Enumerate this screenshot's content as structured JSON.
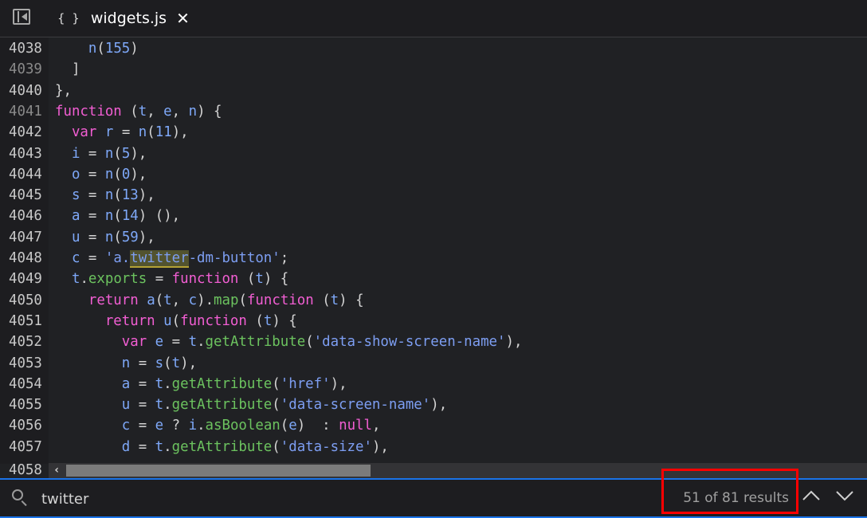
{
  "tab": {
    "icon": "braces-icon",
    "braces": "{ }",
    "title": "widgets.js"
  },
  "code_lines": [
    {
      "num": "4038",
      "dim": false,
      "tokens": [
        [
          "p",
          "    "
        ],
        [
          "id",
          "n"
        ],
        [
          "p",
          "("
        ],
        [
          "num",
          "155"
        ],
        [
          "p",
          ")"
        ]
      ]
    },
    {
      "num": "4039",
      "dim": true,
      "tokens": [
        [
          "p",
          "  ]"
        ]
      ]
    },
    {
      "num": "4040",
      "dim": false,
      "tokens": [
        [
          "p",
          "},"
        ]
      ]
    },
    {
      "num": "4041",
      "dim": true,
      "tokens": [
        [
          "kw",
          "function"
        ],
        [
          "p",
          " ("
        ],
        [
          "id",
          "t"
        ],
        [
          "p",
          ", "
        ],
        [
          "id",
          "e"
        ],
        [
          "p",
          ", "
        ],
        [
          "id",
          "n"
        ],
        [
          "p",
          ") {"
        ]
      ]
    },
    {
      "num": "4042",
      "dim": false,
      "tokens": [
        [
          "p",
          "  "
        ],
        [
          "kw",
          "var"
        ],
        [
          "p",
          " "
        ],
        [
          "id",
          "r"
        ],
        [
          "p",
          " = "
        ],
        [
          "id",
          "n"
        ],
        [
          "p",
          "("
        ],
        [
          "num",
          "11"
        ],
        [
          "p",
          "),"
        ]
      ]
    },
    {
      "num": "4043",
      "dim": false,
      "tokens": [
        [
          "p",
          "  "
        ],
        [
          "id",
          "i"
        ],
        [
          "p",
          " = "
        ],
        [
          "id",
          "n"
        ],
        [
          "p",
          "("
        ],
        [
          "num",
          "5"
        ],
        [
          "p",
          "),"
        ]
      ]
    },
    {
      "num": "4044",
      "dim": false,
      "tokens": [
        [
          "p",
          "  "
        ],
        [
          "id",
          "o"
        ],
        [
          "p",
          " = "
        ],
        [
          "id",
          "n"
        ],
        [
          "p",
          "("
        ],
        [
          "num",
          "0"
        ],
        [
          "p",
          "),"
        ]
      ]
    },
    {
      "num": "4045",
      "dim": false,
      "tokens": [
        [
          "p",
          "  "
        ],
        [
          "id",
          "s"
        ],
        [
          "p",
          " = "
        ],
        [
          "id",
          "n"
        ],
        [
          "p",
          "("
        ],
        [
          "num",
          "13"
        ],
        [
          "p",
          "),"
        ]
      ]
    },
    {
      "num": "4046",
      "dim": false,
      "tokens": [
        [
          "p",
          "  "
        ],
        [
          "id",
          "a"
        ],
        [
          "p",
          " = "
        ],
        [
          "id",
          "n"
        ],
        [
          "p",
          "("
        ],
        [
          "num",
          "14"
        ],
        [
          "p",
          ") (),"
        ]
      ]
    },
    {
      "num": "4047",
      "dim": false,
      "tokens": [
        [
          "p",
          "  "
        ],
        [
          "id",
          "u"
        ],
        [
          "p",
          " = "
        ],
        [
          "id",
          "n"
        ],
        [
          "p",
          "("
        ],
        [
          "num",
          "59"
        ],
        [
          "p",
          "),"
        ]
      ]
    },
    {
      "num": "4048",
      "dim": false,
      "tokens": [
        [
          "p",
          "  "
        ],
        [
          "id",
          "c"
        ],
        [
          "p",
          " = "
        ],
        [
          "str",
          "'a."
        ],
        [
          "hl",
          "twitter"
        ],
        [
          "str",
          "-dm-button'"
        ],
        [
          "p",
          ";"
        ]
      ]
    },
    {
      "num": "4049",
      "dim": false,
      "tokens": [
        [
          "p",
          "  "
        ],
        [
          "id",
          "t"
        ],
        [
          "p",
          "."
        ],
        [
          "fn",
          "exports"
        ],
        [
          "p",
          " = "
        ],
        [
          "kw",
          "function"
        ],
        [
          "p",
          " ("
        ],
        [
          "id",
          "t"
        ],
        [
          "p",
          ") {"
        ]
      ]
    },
    {
      "num": "4050",
      "dim": false,
      "tokens": [
        [
          "p",
          "    "
        ],
        [
          "kw",
          "return"
        ],
        [
          "p",
          " "
        ],
        [
          "id",
          "a"
        ],
        [
          "p",
          "("
        ],
        [
          "id",
          "t"
        ],
        [
          "p",
          ", "
        ],
        [
          "id",
          "c"
        ],
        [
          "p",
          ")."
        ],
        [
          "fn",
          "map"
        ],
        [
          "p",
          "("
        ],
        [
          "kw",
          "function"
        ],
        [
          "p",
          " ("
        ],
        [
          "id",
          "t"
        ],
        [
          "p",
          ") {"
        ]
      ]
    },
    {
      "num": "4051",
      "dim": false,
      "tokens": [
        [
          "p",
          "      "
        ],
        [
          "kw",
          "return"
        ],
        [
          "p",
          " "
        ],
        [
          "id",
          "u"
        ],
        [
          "p",
          "("
        ],
        [
          "kw",
          "function"
        ],
        [
          "p",
          " ("
        ],
        [
          "id",
          "t"
        ],
        [
          "p",
          ") {"
        ]
      ]
    },
    {
      "num": "4052",
      "dim": false,
      "tokens": [
        [
          "p",
          "        "
        ],
        [
          "kw",
          "var"
        ],
        [
          "p",
          " "
        ],
        [
          "id",
          "e"
        ],
        [
          "p",
          " = "
        ],
        [
          "id",
          "t"
        ],
        [
          "p",
          "."
        ],
        [
          "fn",
          "getAttribute"
        ],
        [
          "p",
          "("
        ],
        [
          "str",
          "'data-show-screen-name'"
        ],
        [
          "p",
          "),"
        ]
      ]
    },
    {
      "num": "4053",
      "dim": false,
      "tokens": [
        [
          "p",
          "        "
        ],
        [
          "id",
          "n"
        ],
        [
          "p",
          " = "
        ],
        [
          "id",
          "s"
        ],
        [
          "p",
          "("
        ],
        [
          "id",
          "t"
        ],
        [
          "p",
          "),"
        ]
      ]
    },
    {
      "num": "4054",
      "dim": false,
      "tokens": [
        [
          "p",
          "        "
        ],
        [
          "id",
          "a"
        ],
        [
          "p",
          " = "
        ],
        [
          "id",
          "t"
        ],
        [
          "p",
          "."
        ],
        [
          "fn",
          "getAttribute"
        ],
        [
          "p",
          "("
        ],
        [
          "str",
          "'href'"
        ],
        [
          "p",
          "),"
        ]
      ]
    },
    {
      "num": "4055",
      "dim": false,
      "tokens": [
        [
          "p",
          "        "
        ],
        [
          "id",
          "u"
        ],
        [
          "p",
          " = "
        ],
        [
          "id",
          "t"
        ],
        [
          "p",
          "."
        ],
        [
          "fn",
          "getAttribute"
        ],
        [
          "p",
          "("
        ],
        [
          "str",
          "'data-screen-name'"
        ],
        [
          "p",
          "),"
        ]
      ]
    },
    {
      "num": "4056",
      "dim": false,
      "tokens": [
        [
          "p",
          "        "
        ],
        [
          "id",
          "c"
        ],
        [
          "p",
          " = "
        ],
        [
          "id",
          "e"
        ],
        [
          "p",
          " ? "
        ],
        [
          "id",
          "i"
        ],
        [
          "p",
          "."
        ],
        [
          "fn",
          "asBoolean"
        ],
        [
          "p",
          "("
        ],
        [
          "id",
          "e"
        ],
        [
          "p",
          ")  : "
        ],
        [
          "kw",
          "null"
        ],
        [
          "p",
          ","
        ]
      ]
    },
    {
      "num": "4057",
      "dim": false,
      "tokens": [
        [
          "p",
          "        "
        ],
        [
          "id",
          "d"
        ],
        [
          "p",
          " = "
        ],
        [
          "id",
          "t"
        ],
        [
          "p",
          "."
        ],
        [
          "fn",
          "getAttribute"
        ],
        [
          "p",
          "("
        ],
        [
          "str",
          "'data-size'"
        ],
        [
          "p",
          "),"
        ]
      ]
    }
  ],
  "last_line_num": "4058",
  "find": {
    "query": "twitter",
    "result_count": "51 of 81 results",
    "prev_icon": "chevron-up-icon",
    "next_icon": "chevron-down-icon"
  },
  "colors": {
    "keyword": "#f25ed3",
    "identifier": "#7ea8f8",
    "method": "#6cc35f",
    "match_highlight": "#52532f",
    "focus_border": "#1a73e8",
    "annotation_box": "#ff0000"
  }
}
